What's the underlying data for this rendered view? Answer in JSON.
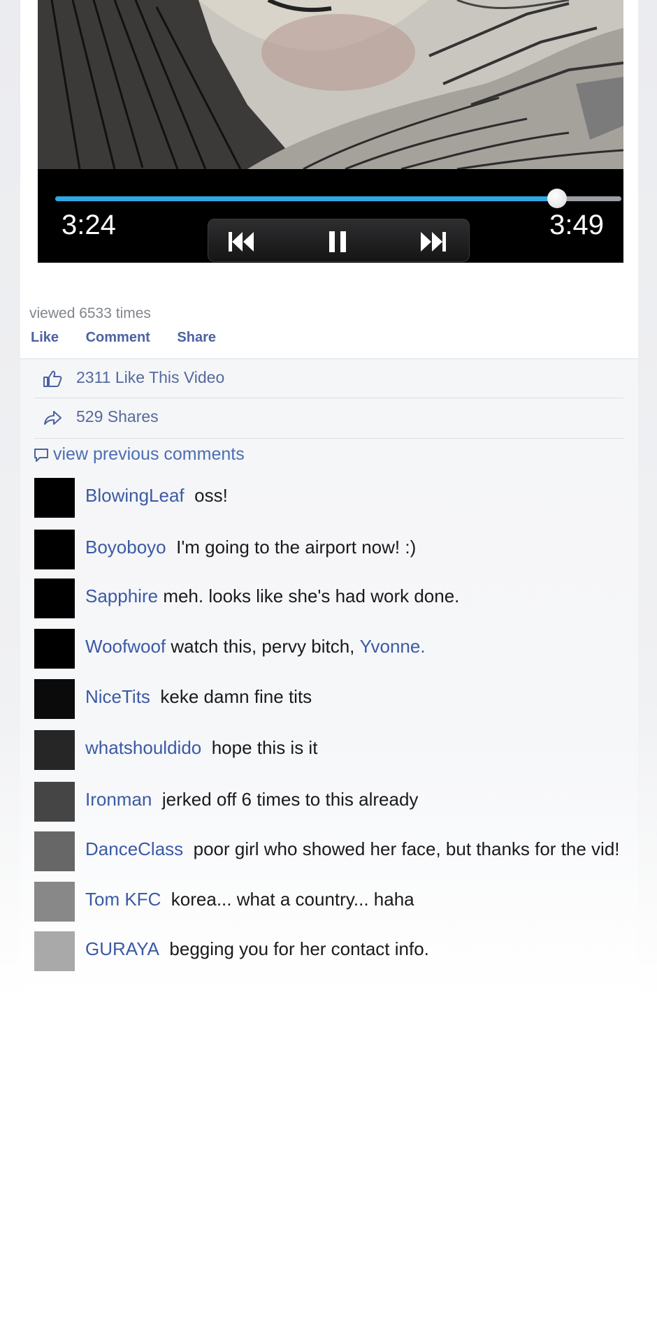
{
  "video": {
    "current_time": "3:24",
    "total_time": "3:49",
    "progress_fraction": 0.887
  },
  "meta": {
    "viewed": "viewed 6533 times",
    "like": "Like",
    "comment": "Comment",
    "share": "Share"
  },
  "stats": {
    "likes": "2311 Like This Video",
    "shares": "529 Shares"
  },
  "comments_section": {
    "view_previous": "view previous comments",
    "items": [
      {
        "name": "BlowingLeaf",
        "text": "oss!",
        "avatar_color": "#000000"
      },
      {
        "name": "Boyoboyo",
        "text": "I'm going to the airport now! :)",
        "avatar_color": "#000000"
      },
      {
        "name": "Sapphire",
        "text": "meh. looks like she's had work done.",
        "avatar_color": "#000000"
      },
      {
        "name": "Woofwoof",
        "text": "watch this, pervy bitch,",
        "mention": "Yvonne.",
        "avatar_color": "#000000"
      },
      {
        "name": "NiceTits",
        "text": "keke damn fine tits",
        "avatar_color": "#0b0b0b"
      },
      {
        "name": "whatshouldido",
        "text": "hope this is it",
        "avatar_color": "#262626"
      },
      {
        "name": "Ironman",
        "text": "jerked off 6 times to this already",
        "avatar_color": "#454545"
      },
      {
        "name": "DanceClass",
        "text": "poor girl who showed her face, but thanks for the vid!",
        "avatar_color": "#676767"
      },
      {
        "name": "Tom KFC",
        "text": "korea... what a country... haha",
        "avatar_color": "#888888"
      },
      {
        "name": "GURAYA",
        "text": "begging you for her contact info.",
        "avatar_color": "#a9a9a9"
      }
    ]
  },
  "colors": {
    "accent_link": "#3b5aa6",
    "seek_fill": "#2ea7e3"
  }
}
